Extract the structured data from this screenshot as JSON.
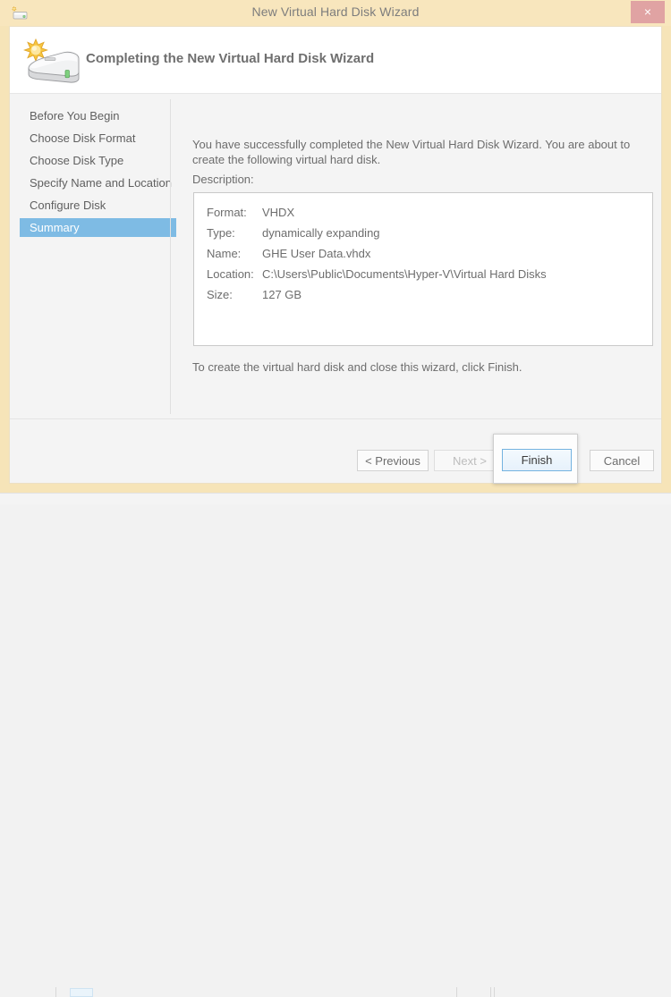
{
  "window": {
    "title": "New Virtual Hard Disk Wizard",
    "icon": "virtual-hard-disk-icon",
    "close_label": "×",
    "titlebar_color": "#f8e6bd",
    "close_color": "#e0a3a3"
  },
  "header": {
    "title": "Completing the New Virtual Hard Disk Wizard",
    "icon": "new-hard-disk-icon"
  },
  "sidebar": {
    "items": [
      {
        "label": "Before You Begin",
        "selected": false
      },
      {
        "label": "Choose Disk Format",
        "selected": false
      },
      {
        "label": "Choose Disk Type",
        "selected": false
      },
      {
        "label": "Specify Name and Location",
        "selected": false
      },
      {
        "label": "Configure Disk",
        "selected": false
      },
      {
        "label": "Summary",
        "selected": true
      }
    ],
    "selected_color": "#7ebbe4"
  },
  "content": {
    "intro": "You have successfully completed the New Virtual Hard Disk Wizard. You are about to create the following virtual hard disk.",
    "description_label": "Description:",
    "description_rows": [
      {
        "key": "Format:",
        "value": "VHDX"
      },
      {
        "key": "Type:",
        "value": "dynamically expanding"
      },
      {
        "key": "Name:",
        "value": "GHE User Data.vhdx"
      },
      {
        "key": "Location:",
        "value": "C:\\Users\\Public\\Documents\\Hyper-V\\Virtual Hard Disks"
      },
      {
        "key": "Size:",
        "value": "127 GB"
      }
    ],
    "outro": "To create the virtual hard disk and close this wizard, click Finish."
  },
  "footer": {
    "previous_label": "< Previous",
    "next_label": "Next >",
    "next_disabled": true,
    "finish_label": "Finish",
    "cancel_label": "Cancel"
  }
}
